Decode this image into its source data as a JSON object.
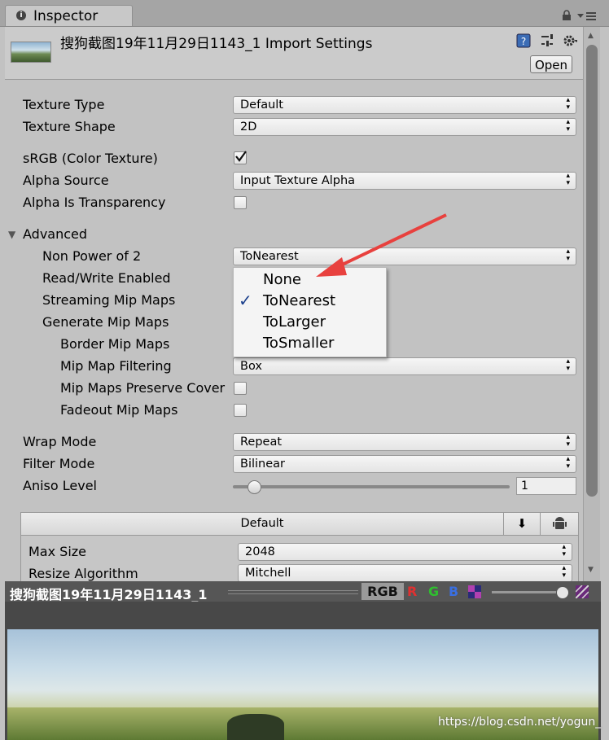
{
  "tab": {
    "label": "Inspector"
  },
  "header": {
    "title": "搜狗截图19年11月29日1143_1 Import Settings",
    "open_label": "Open"
  },
  "fields": {
    "texture_type": {
      "label": "Texture Type",
      "value": "Default"
    },
    "texture_shape": {
      "label": "Texture Shape",
      "value": "2D"
    },
    "srgb": {
      "label": "sRGB (Color Texture)",
      "checked": true
    },
    "alpha_source": {
      "label": "Alpha Source",
      "value": "Input Texture Alpha"
    },
    "alpha_transparency": {
      "label": "Alpha Is Transparency",
      "checked": false
    }
  },
  "advanced": {
    "label": "Advanced",
    "non_power_of_2": {
      "label": "Non Power of 2",
      "value": "ToNearest"
    },
    "read_write": {
      "label": "Read/Write Enabled"
    },
    "streaming": {
      "label": "Streaming Mip Maps"
    },
    "generate_mip": {
      "label": "Generate Mip Maps"
    },
    "border_mip": {
      "label": "Border Mip Maps"
    },
    "mip_filtering": {
      "label": "Mip Map Filtering",
      "value": "Box"
    },
    "preserve_coverage": {
      "label": "Mip Maps Preserve Cover",
      "checked": false
    },
    "fadeout": {
      "label": "Fadeout Mip Maps",
      "checked": false
    }
  },
  "popup": {
    "options": [
      "None",
      "ToNearest",
      "ToLarger",
      "ToSmaller"
    ],
    "checked_index": 1,
    "check_glyph": "✓"
  },
  "wrap": {
    "label": "Wrap Mode",
    "value": "Repeat"
  },
  "filter": {
    "label": "Filter Mode",
    "value": "Bilinear"
  },
  "aniso": {
    "label": "Aniso Level",
    "value": "1",
    "slider_fraction": 0.0
  },
  "platform": {
    "tab_label": "Default",
    "max_size": {
      "label": "Max Size",
      "value": "2048"
    },
    "resize": {
      "label": "Resize Algorithm",
      "value": "Mitchell"
    }
  },
  "preview": {
    "title": "搜狗截图19年11月29日1143_1",
    "rgb": "RGB",
    "r": "R",
    "g": "G",
    "b": "B",
    "watermark": "https://blog.csdn.net/yogun_"
  },
  "colors": {
    "annotation_arrow": "#e8413e",
    "red_channel": "#e03030",
    "green_channel": "#2fbf2f",
    "blue_channel": "#3a6fe0"
  }
}
